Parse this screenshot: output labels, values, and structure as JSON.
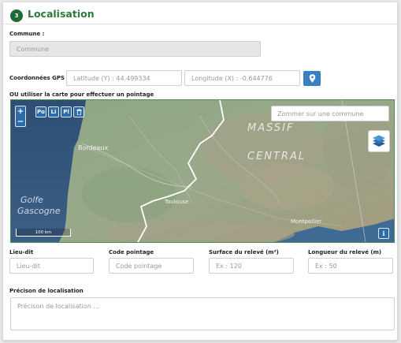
{
  "section": {
    "step_number": "3",
    "title": "Localisation"
  },
  "commune": {
    "label": "Commune :",
    "placeholder": "Commune"
  },
  "gps": {
    "label": "Coordonnées GPS",
    "latitude": "Latitude (Y) : 44.499334",
    "longitude": "Longitude (X) : -0.644776",
    "locate_icon": "map-marker-icon"
  },
  "map": {
    "instruction": "OU utiliser la carte pour effectuer un pointage",
    "zoom_in": "+",
    "zoom_out": "−",
    "tools": [
      "Po",
      "Li",
      "Pl"
    ],
    "tool_delete_icon": "trash-icon",
    "search_placeholder": "Zommer sur une commune",
    "layers_icon": "layers-icon",
    "info_label": "i",
    "scale_label": "100 km",
    "place_labels": {
      "massif_1": "MASSIF",
      "massif_2": "CENTRAL",
      "golfe_1": "Golfe",
      "golfe_2": "Gascogne",
      "bordeaux": "Bordeaux",
      "montpellier": "Montpellier",
      "toulouse": "Toulouse"
    }
  },
  "fields": {
    "lieu_dit": {
      "label": "Lieu-dit",
      "placeholder": "Lieu-dit"
    },
    "code_pointage": {
      "label": "Code pointage",
      "placeholder": "Code pointage"
    },
    "surface": {
      "label": "Surface du relevé (m²)",
      "placeholder": "Ex : 120"
    },
    "longueur": {
      "label": "Longueur du relevé (m)",
      "placeholder": "Ex : 50"
    }
  },
  "precision": {
    "label": "Précison de localisation",
    "placeholder": "Précison de localisation ..."
  },
  "colors": {
    "accent_green": "#2b7a3c",
    "button_blue": "#3a7fc2"
  }
}
